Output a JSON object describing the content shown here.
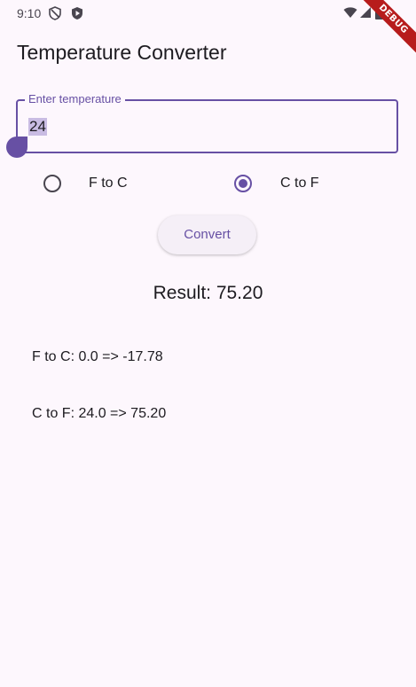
{
  "status_bar": {
    "time": "9:10",
    "icons_left": [
      "shield-icon",
      "play-protect-icon"
    ],
    "icons_right": [
      "wifi-icon",
      "signal-icon",
      "battery-icon"
    ]
  },
  "debug_banner": "DEBUG",
  "app_bar": {
    "title": "Temperature Converter"
  },
  "input": {
    "label": "Enter temperature",
    "value": "24"
  },
  "conversion_options": [
    {
      "label": "F to C",
      "selected": false
    },
    {
      "label": "C to F",
      "selected": true
    }
  ],
  "convert_button": {
    "label": "Convert"
  },
  "result_text": "Result: 75.20",
  "history": [
    "F to C: 0.0 => -17.78",
    "C to F: 24.0 => 75.20"
  ],
  "colors": {
    "primary": "#6750a4",
    "background": "#fdf7fd",
    "text": "#1d1b20",
    "debug_banner": "#b71c1c"
  }
}
